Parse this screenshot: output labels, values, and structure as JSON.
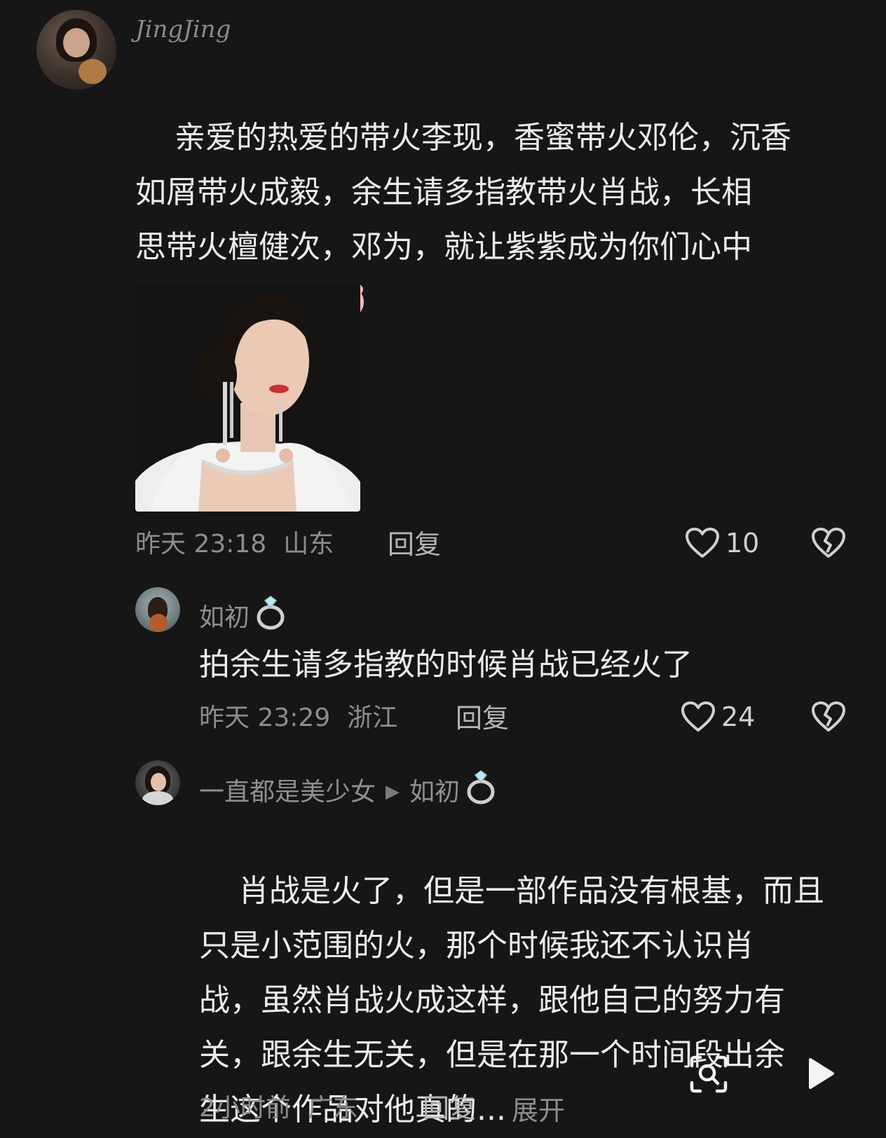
{
  "comment1": {
    "username": "JingJing",
    "text": "亲爱的热爱的带火李现，香蜜带火邓伦，沉香\n如屑带火成毅，余生请多指教带火肖战，长相\n思带火檀健次，邓为，就让紫紫成为你们心中\n的刺吧",
    "time": "昨天 23:18",
    "location": "山东",
    "reply_label": "回复",
    "likes": "10"
  },
  "comment2": {
    "username": "如初",
    "text": "拍余生请多指教的时候肖战已经火了",
    "time": "昨天 23:29",
    "location": "浙江",
    "reply_label": "回复",
    "likes": "24"
  },
  "comment3": {
    "username": "一直都是美少女",
    "reply_to": "如初",
    "text": "肖战是火了，但是一部作品没有根基，而且\n只是小范围的火，那个时候我还不认识肖\n战，虽然肖战火成这样，跟他自己的努力有\n关，跟余生无关，但是在那一个时间段出余\n生这个作品对他真的...",
    "expand_label": "展开",
    "time": "2小时前",
    "location": "广东",
    "reply_label": "回复"
  },
  "icons": {
    "like": "heart-outline-icon",
    "dislike": "broken-heart-icon",
    "emoji": "pig-face-emoji",
    "badge": "diamond-ring-emoji",
    "search": "image-search-icon",
    "play": "play-icon"
  },
  "colors": {
    "background": "#161616",
    "text": "#ececec",
    "meta": "#8d8d8d"
  }
}
